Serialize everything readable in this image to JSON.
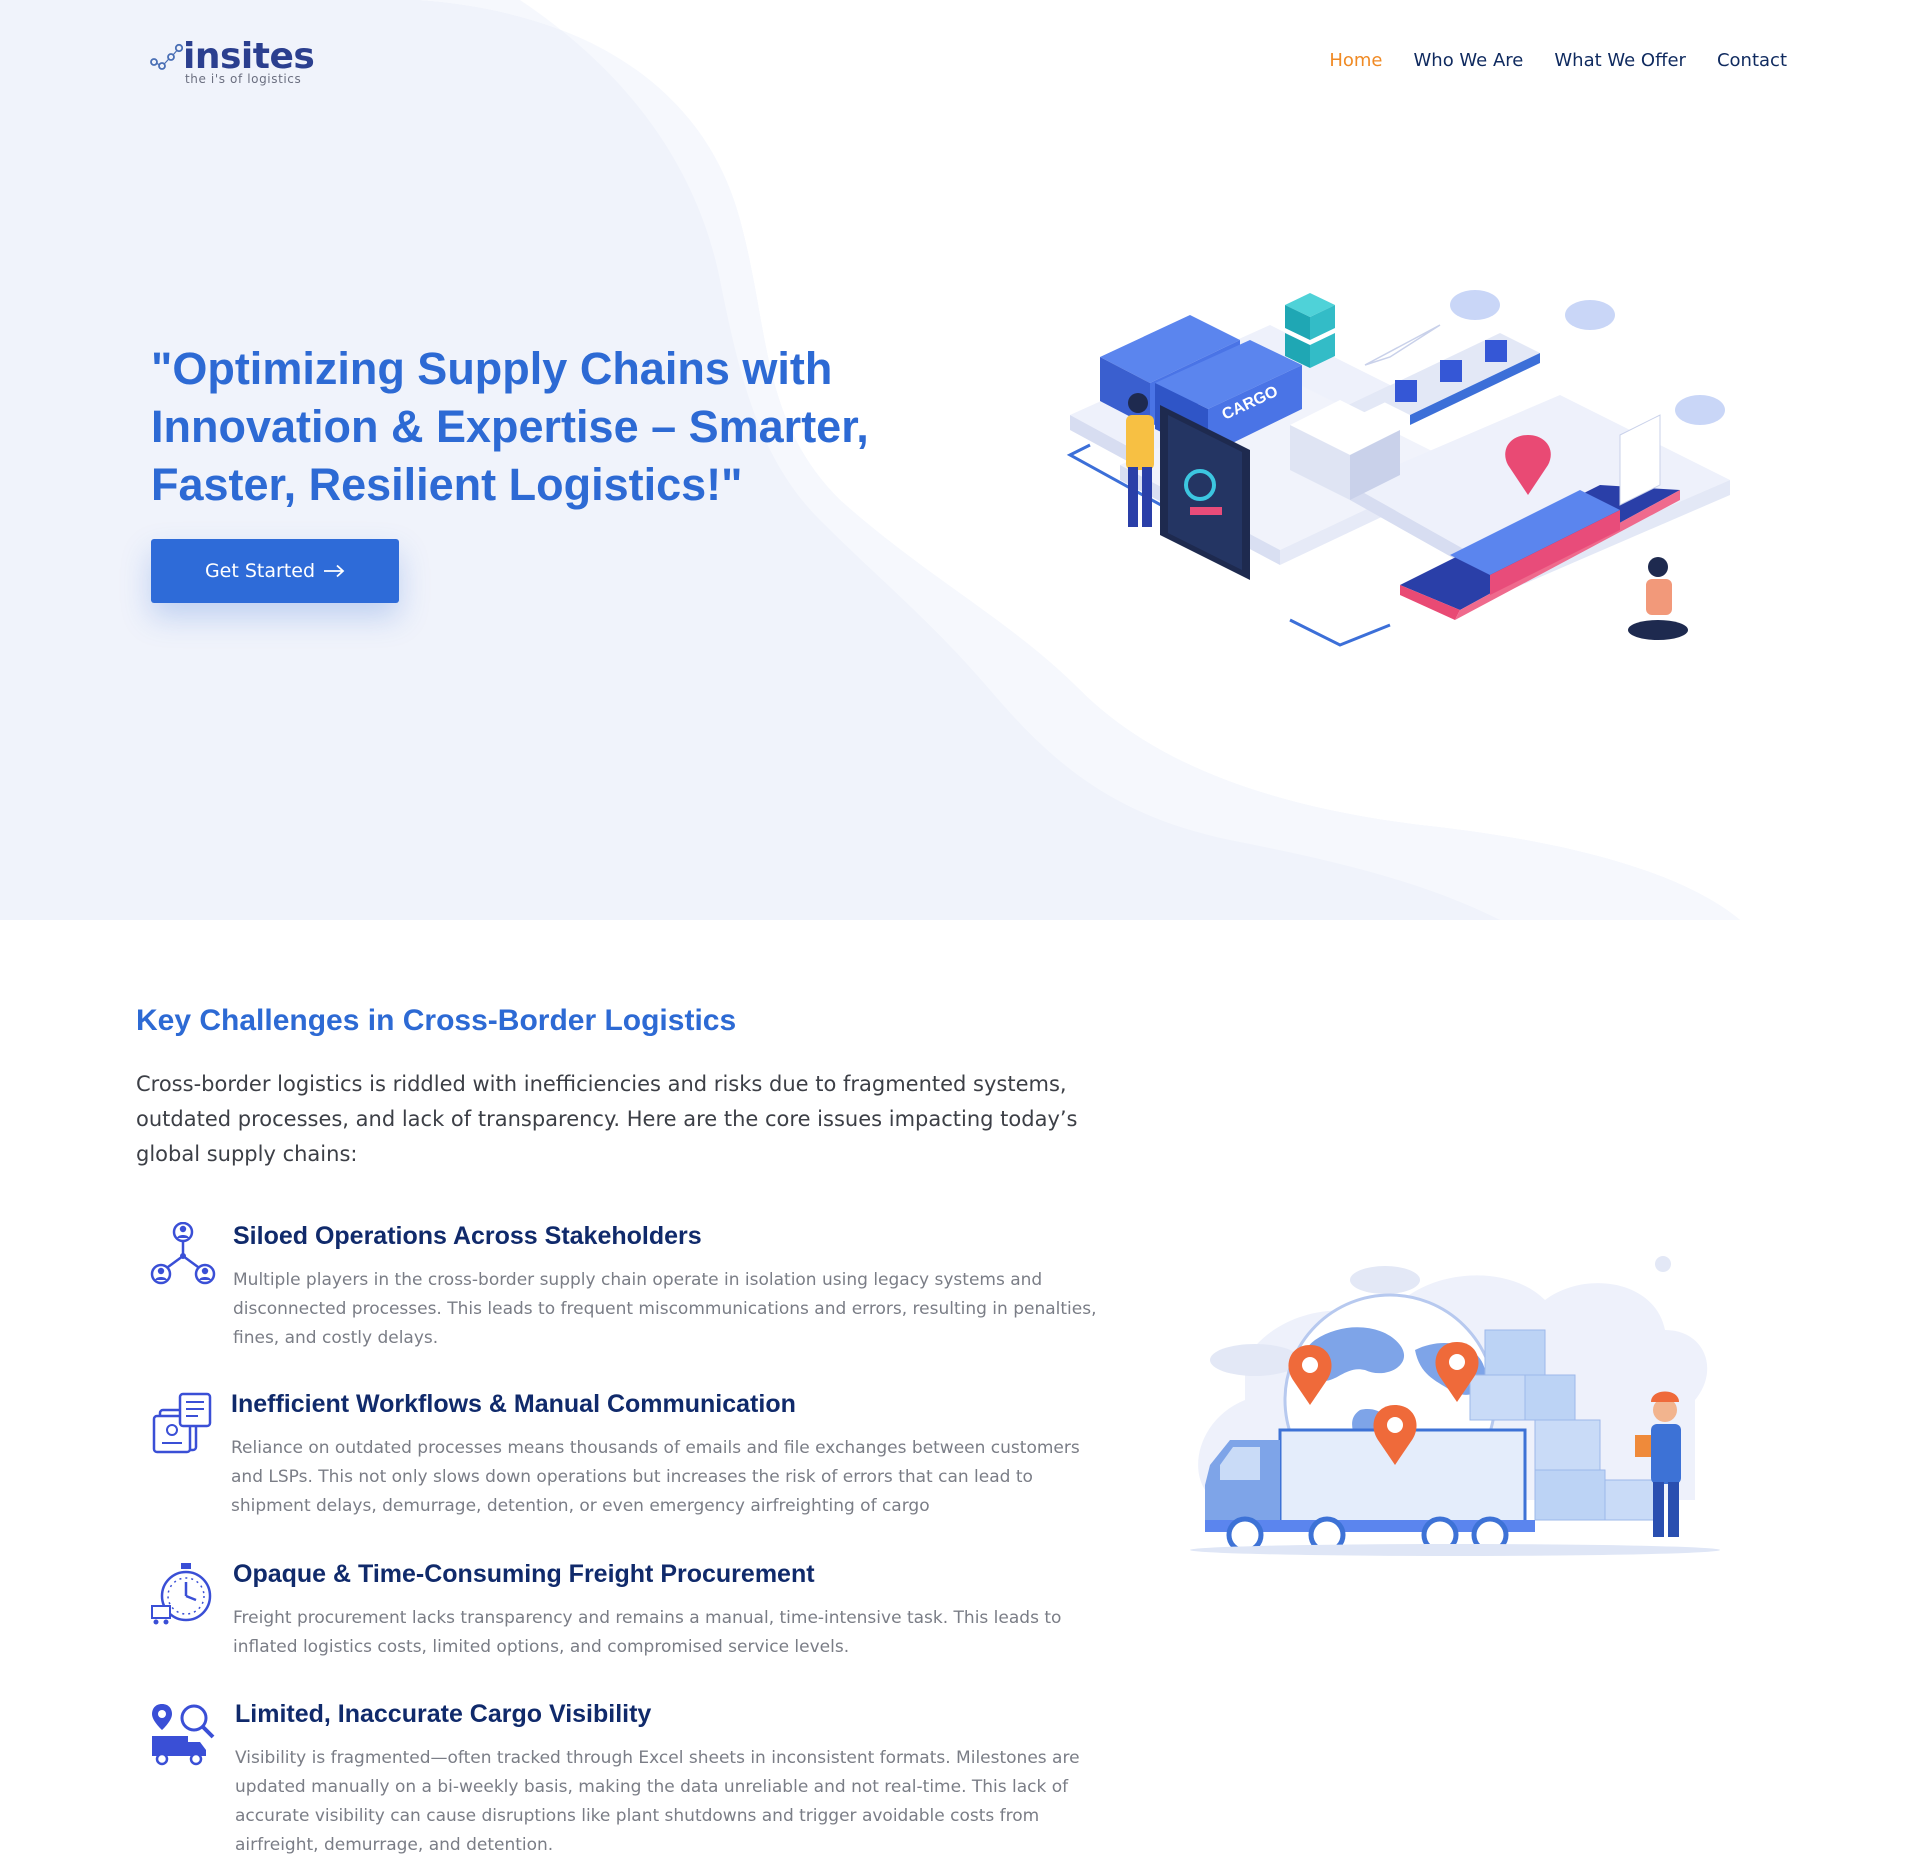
{
  "header": {
    "logo": {
      "name": "insites",
      "tagline": "the i's of logistics"
    },
    "nav": [
      {
        "label": "Home",
        "active": true
      },
      {
        "label": "Who We Are",
        "active": false
      },
      {
        "label": "What We Offer",
        "active": false
      },
      {
        "label": "Contact",
        "active": false
      }
    ]
  },
  "hero": {
    "title": "\"Optimizing Supply Chains with Innovation & Expertise – Smarter, Faster, Resilient Logistics!\"",
    "cta_label": "Get Started",
    "illustration_label": "CARGO"
  },
  "challenges": {
    "title": "Key Challenges in Cross-Border Logistics",
    "intro": "Cross-border logistics is riddled with inefficiencies and risks due to fragmented systems, outdated processes, and lack of transparency. Here are the core issues impacting today’s global supply chains:",
    "items": [
      {
        "icon": "stakeholders-network-icon",
        "title": "Siloed Operations Across Stakeholders",
        "text": "Multiple players in the cross-border supply chain operate in isolation using legacy systems and disconnected processes. This leads to frequent miscommunications and errors, resulting in penalties, fines, and costly delays."
      },
      {
        "icon": "manual-documents-icon",
        "title": "Inefficient Workflows & Manual Communication",
        "text": "Reliance on outdated processes means thousands of emails and file exchanges between customers and LSPs. This not only slows down operations but increases the risk of errors that can lead to shipment delays, demurrage, detention, or even emergency airfreighting of cargo"
      },
      {
        "icon": "stopwatch-cart-icon",
        "title": "Opaque & Time-Consuming Freight Procurement",
        "text": "Freight procurement lacks transparency and remains a manual, time-intensive task. This leads to inflated logistics costs, limited options, and compromised service levels."
      },
      {
        "icon": "truck-tracking-icon",
        "title": "Limited, Inaccurate Cargo Visibility",
        "text": "Visibility is fragmented—often tracked through Excel sheets in inconsistent formats. Milestones are updated manually on a bi-weekly basis, making the data unreliable and not real-time. This lack of accurate visibility can cause disruptions like plant shutdowns and trigger avoidable costs from airfreight, demurrage, and detention."
      }
    ]
  },
  "colors": {
    "brand_blue": "#2d6ad4",
    "navy": "#102a6b",
    "accent_orange": "#f08a24",
    "hero_bg": "#f0f3fb"
  }
}
